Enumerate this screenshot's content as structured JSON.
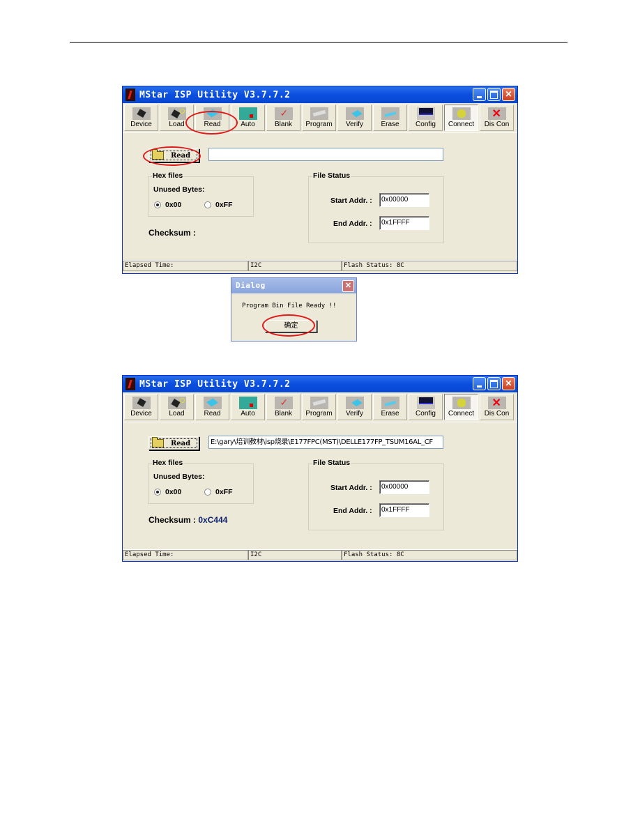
{
  "page": {
    "accent_red": "#e01a1a"
  },
  "windows": [
    {
      "title": "MStar ISP Utility V3.7.7.2",
      "toolbar": [
        {
          "label": "Device",
          "icon": "chip-icon"
        },
        {
          "label": "Load",
          "icon": "load-chip-icon"
        },
        {
          "label": "Read",
          "icon": "read-icon"
        },
        {
          "label": "Auto",
          "icon": "auto-icon"
        },
        {
          "label": "Blank",
          "icon": "blank-check-icon"
        },
        {
          "label": "Program",
          "icon": "program-icon"
        },
        {
          "label": "Verify",
          "icon": "verify-icon"
        },
        {
          "label": "Erase",
          "icon": "erase-icon"
        },
        {
          "label": "Config",
          "icon": "config-icon"
        },
        {
          "label": "Connect",
          "icon": "connect-phone-icon"
        },
        {
          "label": "Dis Con",
          "icon": "disconnect-icon"
        }
      ],
      "read_button": "Read",
      "path_value": "",
      "hex_group": "Hex files",
      "unused_bytes_label": "Unused Bytes:",
      "radio_00": "0x00",
      "radio_ff": "0xFF",
      "checksum_label": "Checksum :",
      "checksum_value": "",
      "file_status_group": "File Status",
      "start_addr_label": "Start Addr. :",
      "start_addr_value": "0x00000",
      "end_addr_label": "End Addr. :",
      "end_addr_value": "0x1FFFF",
      "status": {
        "elapsed": "Elapsed Time:",
        "interface": "I2C",
        "flash": "Flash Status: 8C"
      }
    },
    {
      "title": "MStar ISP Utility V3.7.7.2",
      "toolbar": [
        {
          "label": "Device"
        },
        {
          "label": "Load"
        },
        {
          "label": "Read"
        },
        {
          "label": "Auto"
        },
        {
          "label": "Blank"
        },
        {
          "label": "Program"
        },
        {
          "label": "Verify"
        },
        {
          "label": "Erase"
        },
        {
          "label": "Config"
        },
        {
          "label": "Connect"
        },
        {
          "label": "Dis Con"
        }
      ],
      "read_button": "Read",
      "path_value": "E:\\gary\\培训教材\\isp烧录\\E177FPC(MST)\\DELLE177FP_TSUM16AL_CF",
      "hex_group": "Hex files",
      "unused_bytes_label": "Unused Bytes:",
      "radio_00": "0x00",
      "radio_ff": "0xFF",
      "checksum_label": "Checksum :",
      "checksum_value": "0xC444",
      "file_status_group": "File Status",
      "start_addr_label": "Start Addr. :",
      "start_addr_value": "0x00000",
      "end_addr_label": "End Addr. :",
      "end_addr_value": "0x1FFFF",
      "status": {
        "elapsed": "Elapsed Time:",
        "interface": "I2C",
        "flash": "Flash Status: 8C"
      }
    }
  ],
  "dialog": {
    "title": "Dialog",
    "message": "Program Bin File Ready !!",
    "ok_label": "确定"
  }
}
